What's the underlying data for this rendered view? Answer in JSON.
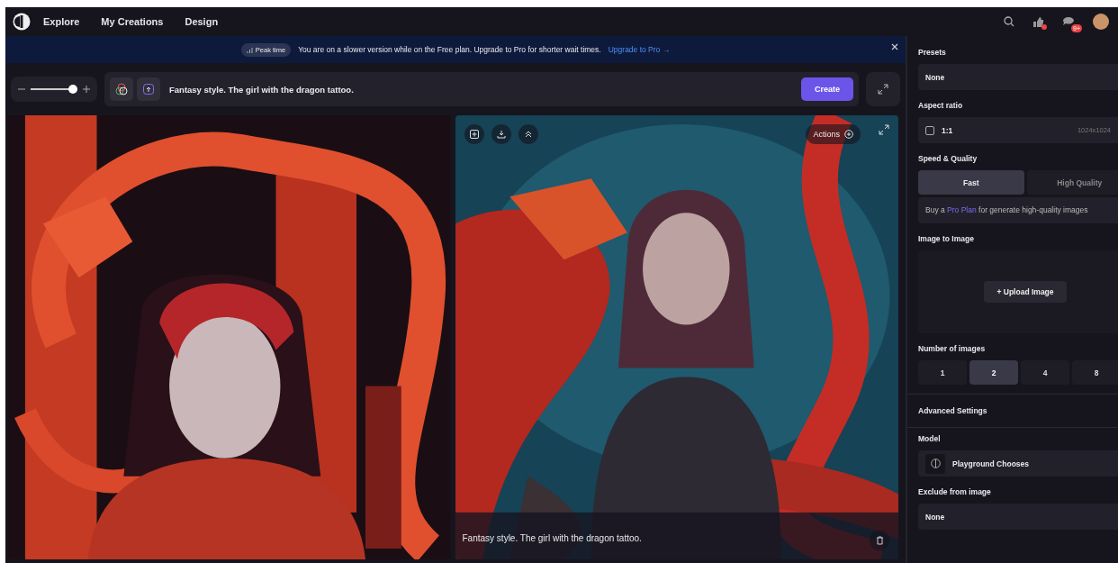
{
  "nav": {
    "items": [
      {
        "label": "Explore"
      },
      {
        "label": "My Creations"
      },
      {
        "label": "Design"
      }
    ],
    "notification_badge": "9+"
  },
  "banner": {
    "badge": "Peak time",
    "message": "You are on a slower version while on the Free plan. Upgrade to Pro for shorter wait times.",
    "link": "Upgrade to Pro →"
  },
  "toolbar": {
    "zoom": {
      "level": 0.9
    },
    "prompt": "Fantasy style. The girl with the dragon tattoo.",
    "create_button": "Create"
  },
  "images": [
    {
      "kind": "picture"
    },
    {
      "kind": "picture",
      "actions": "Actions",
      "caption": "Fantasy style. The girl with the dragon tattoo."
    }
  ],
  "panel": {
    "presets": {
      "label": "Presets",
      "value": "None"
    },
    "aspect_ratio": {
      "label": "Aspect ratio",
      "checked": false,
      "value": "1:1",
      "size": "1024x1024"
    },
    "speed_quality": {
      "label": "Speed & Quality",
      "options": [
        {
          "label": "Fast",
          "selected": true
        },
        {
          "label": "High Quality",
          "selected": false
        }
      ],
      "note_before": "Buy a ",
      "note_link": "Pro Plan",
      "note_after": " for generate high-quality images"
    },
    "image_to_image": {
      "label": "Image to Image",
      "button": "+ Upload Image"
    },
    "number_of_images": {
      "label": "Number of images",
      "options": [
        {
          "label": "1",
          "selected": false
        },
        {
          "label": "2",
          "selected": true
        },
        {
          "label": "4",
          "selected": false
        },
        {
          "label": "8",
          "selected": false
        }
      ]
    },
    "advanced": {
      "label": "Advanced Settings"
    },
    "model": {
      "label": "Model",
      "value": "Playground Chooses"
    },
    "exclude": {
      "label": "Exclude from image",
      "value": "None"
    }
  }
}
